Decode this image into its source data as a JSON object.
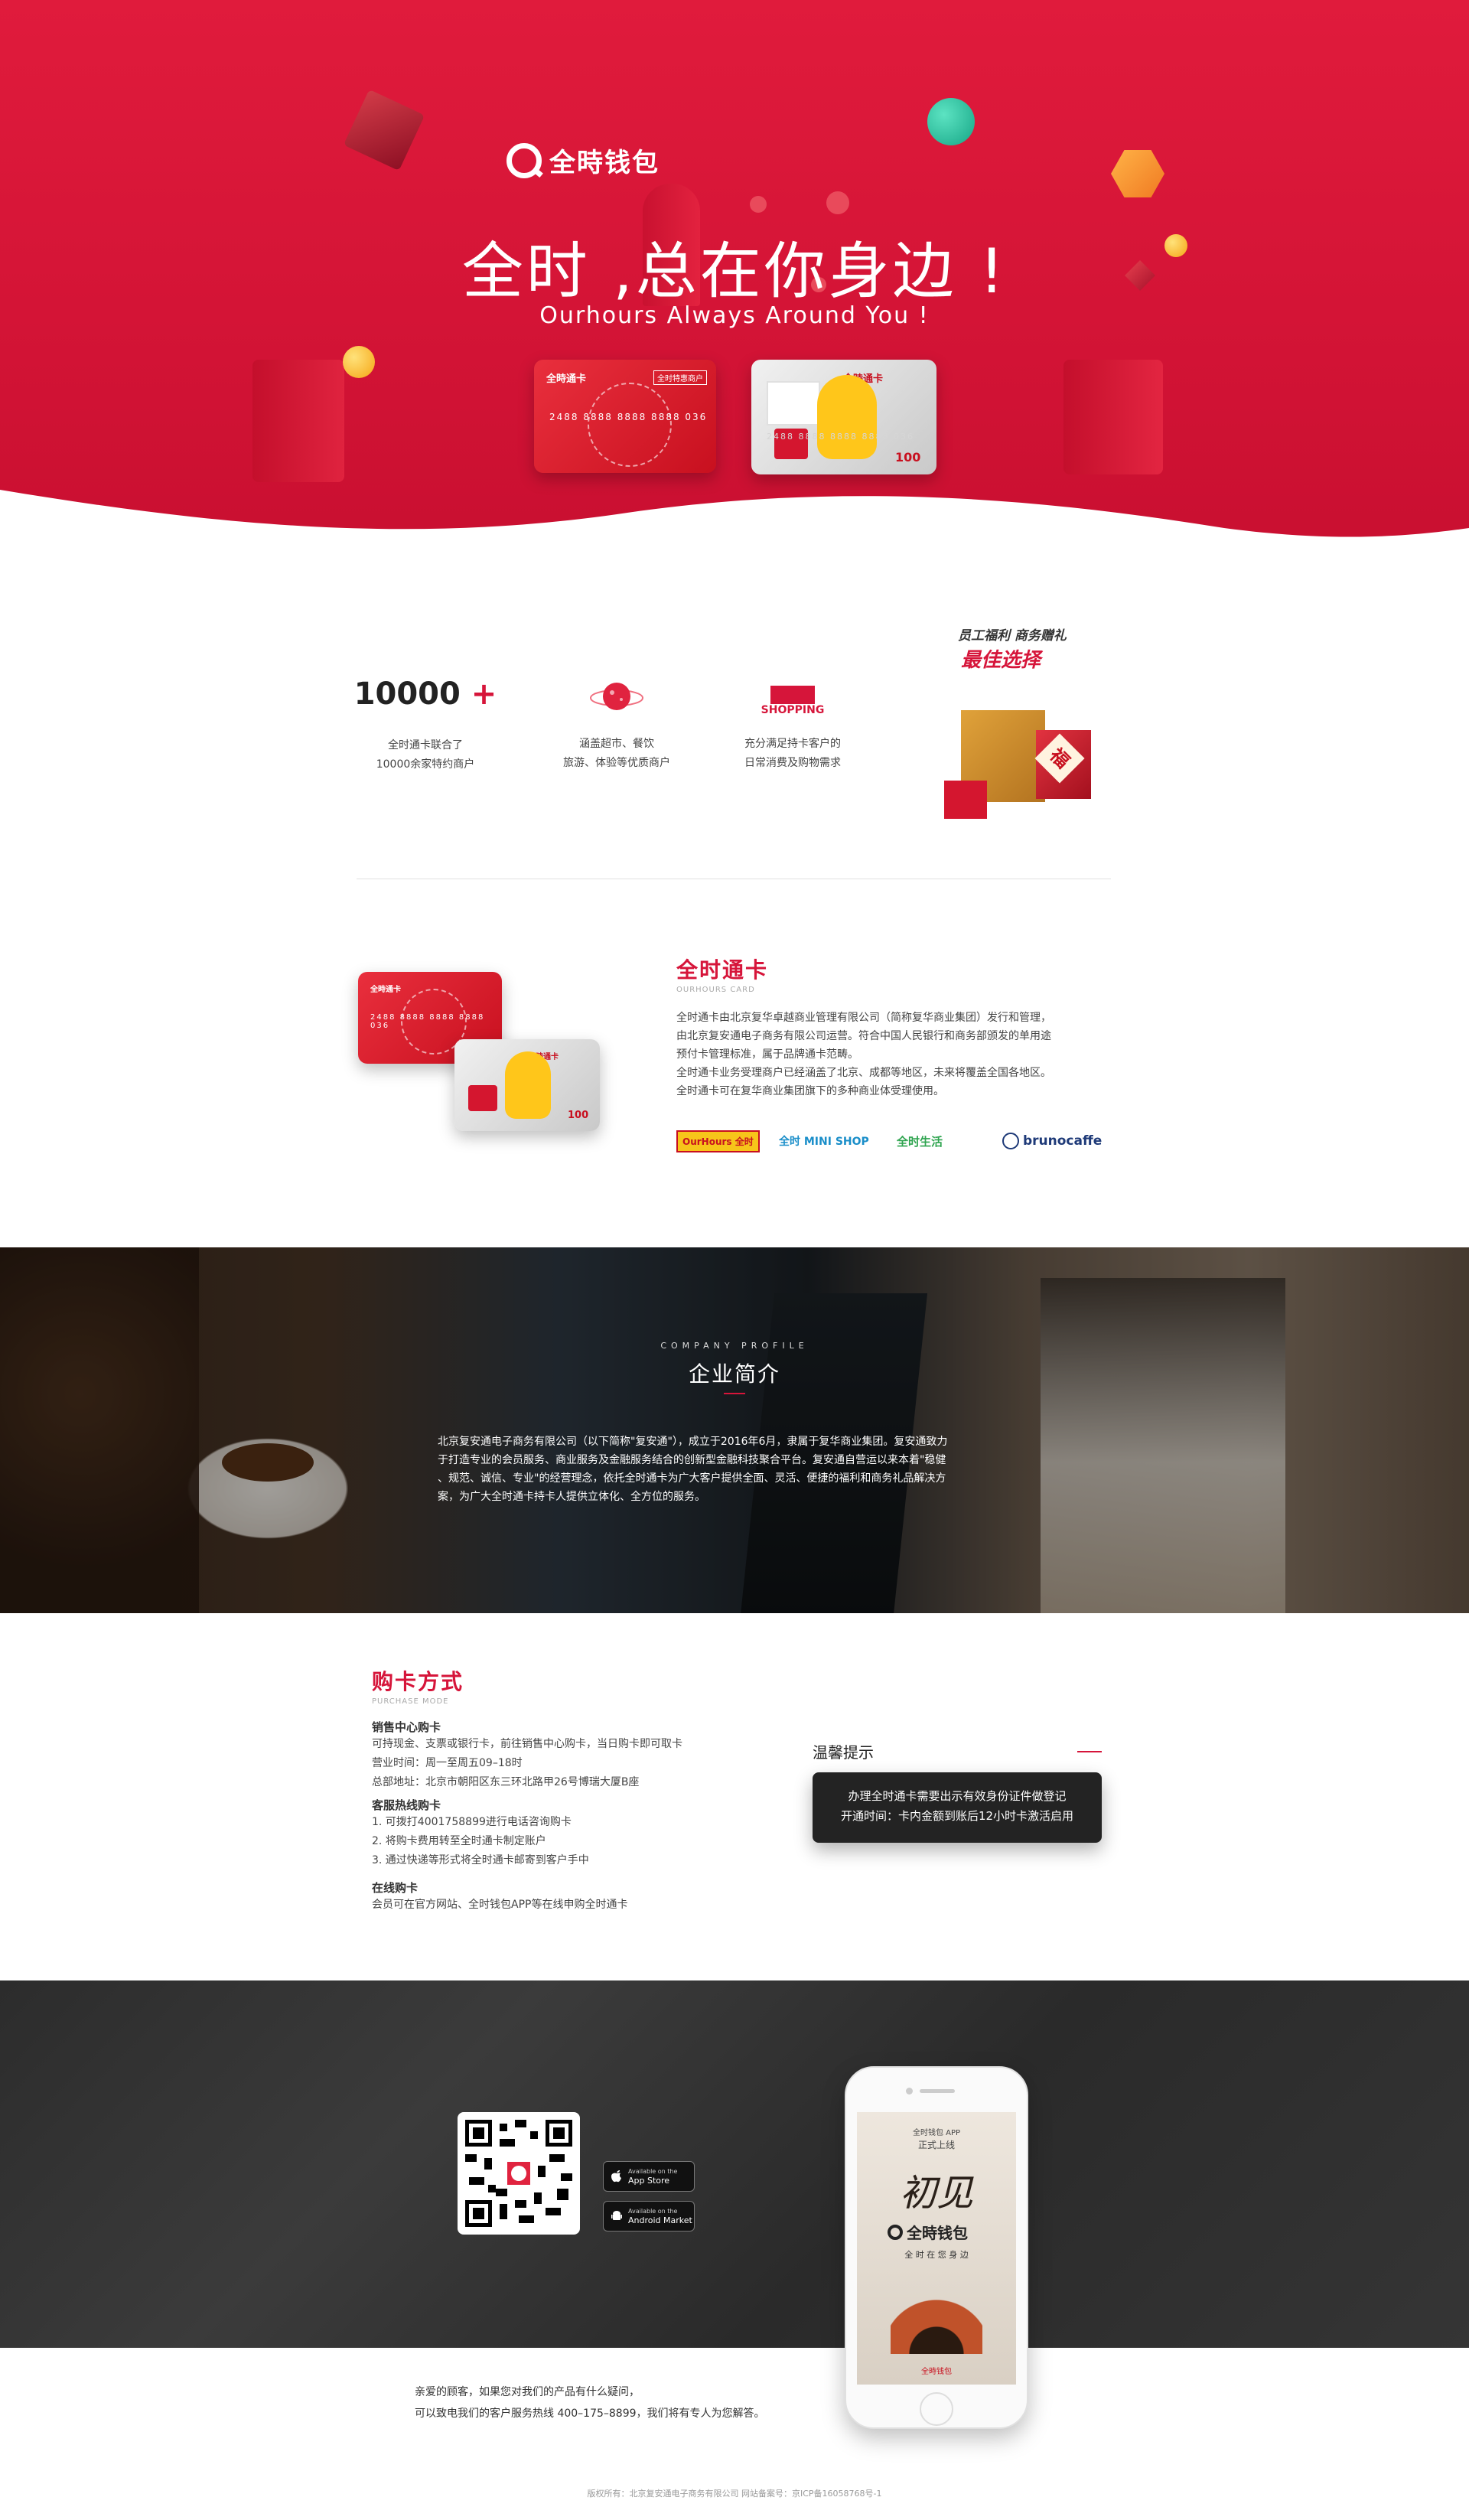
{
  "hero": {
    "logo_text": "全時钱包",
    "title": "全时 ,总在你身边 !",
    "subtitle": "Ourhours Always Around You !",
    "card_red": {
      "brand": "全時通卡",
      "badge": "全时特惠商户",
      "number": "2488 8888 8888 8888 036"
    },
    "card_silver": {
      "brand": "全時通卡",
      "number": "2488 8888 8888 8888 036",
      "value": "100"
    }
  },
  "features": {
    "items": [
      {
        "big": "10000",
        "plus": "+",
        "line1": "全时通卡联合了",
        "line2": "10000余家特约商户"
      },
      {
        "icon": "planet-icon",
        "line1": "涵盖超市、餐饮",
        "line2": "旅游、体验等优质商户"
      },
      {
        "icon": "shopping-icon",
        "icon_text": "SHOPPING",
        "line1": "充分满足持卡客户的",
        "line2": "日常消费及购物需求"
      }
    ],
    "gift": {
      "line1": "员工福利 商务赠礼",
      "line2": "最佳选择",
      "tag": "福"
    }
  },
  "card_info": {
    "title": "全时通卡",
    "subtitle": "OURHOURS CARD",
    "para1": "全时通卡由北京复华卓越商业管理有限公司（简称复华商业集团）发行和管理，",
    "para2": "由北京复安通电子商务有限公司运营。符合中国人民银行和商务部颁发的单用途",
    "para3": "预付卡管理标准，属于品牌通卡范畴。",
    "para4": "全时通卡业务受理商户已经涵盖了北京、成都等地区，未来将覆盖全国各地区。",
    "para5": "全时通卡可在复华商业集团旗下的多种商业体受理使用。",
    "brands": [
      "OurHours 全时",
      "全时 MINI SHOP",
      "全时生活",
      "brunocaffe"
    ]
  },
  "company": {
    "eyebrow": "COMPANY PROFILE",
    "title": "企业简介",
    "line1": "北京复安通电子商务有限公司（以下简称\"复安通\"），成立于2016年6月，隶属于复华商业集团。复安通致力",
    "line2": "于打造专业的会员服务、商业服务及金融服务结合的创新型金融科技聚合平台。复安通自营运以来本着\"稳健",
    "line3": "、规范、诚信、专业\"的经营理念，依托全时通卡为广大客户提供全面、灵活、便捷的福利和商务礼品解决方",
    "line4": "案，为广大全时通卡持卡人提供立体化、全方位的服务。"
  },
  "purchase": {
    "title": "购卡方式",
    "subtitle": "PURCHASE MODE",
    "s1_head": "销售中心购卡",
    "s1_l1": "可持现金、支票或银行卡，前往销售中心购卡，当日购卡即可取卡",
    "s1_l2": "营业时间：周一至周五09–18时",
    "s1_l3": "总部地址：北京市朝阳区东三环北路甲26号博瑞大厦B座",
    "s2_head": "客服热线购卡",
    "s2_l1": "1.    可拨打4001758899进行电话咨询购卡",
    "s2_l2": "2.    将购卡费用转至全时通卡制定账户",
    "s2_l3": "3.    通过快递等形式将全时通卡邮寄到客户手中",
    "s3_head": "在线购卡",
    "s3_l1": "会员可在官方网站、全时钱包APP等在线申购全时通卡",
    "tip_title": "温馨提示",
    "tip_l1": "办理全时通卡需要出示有效身份证件做登记",
    "tip_l2": "开通时间：卡内金额到账后12小时卡激活启用"
  },
  "app": {
    "appstore_small": "Available on the",
    "appstore_big": "App Store",
    "android_small": "Available on the",
    "android_big": "Android Market",
    "phone_top1": "全时钱包 APP",
    "phone_top2": "正式上线",
    "phone_big": "初见",
    "phone_logo": "全時钱包",
    "phone_tagline": "全 时 在 您 身 边",
    "phone_footer": "全時钱包"
  },
  "footer": {
    "contact1": "亲爱的顾客，如果您对我们的产品有什么疑问，",
    "contact2": "可以致电我们的客户服务热线 400–175–8899，我们将有专人为您解答。",
    "copyright": "版权所有：北京复安通电子商务有限公司      网站备案号：京ICP备16058768号-1"
  },
  "colors": {
    "brand_red": "#d6153a",
    "dark": "#232323"
  }
}
